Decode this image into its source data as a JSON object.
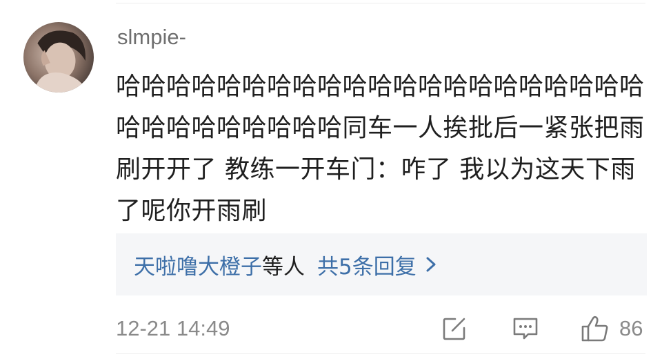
{
  "comment": {
    "username": "slmpie-",
    "text": "哈哈哈哈哈哈哈哈哈哈哈哈哈哈哈哈哈哈哈哈哈哈哈哈哈哈哈哈哈哈同车一人挨批后一紧张把雨刷开开了 教练一开车门：咋了 我以为这天下雨了呢你开雨刷",
    "avatar_icon": "user-avatar-photo"
  },
  "replies": {
    "names": "天啦噜大橙子",
    "etc": "等人",
    "count_label": "共5条回复",
    "chevron_icon": "chevron-right-icon",
    "link_color": "#3d6fa8"
  },
  "footer": {
    "timestamp": "12-21 14:49",
    "edit_icon": "share-edit-icon",
    "comment_icon": "comment-bubble-icon",
    "like_icon": "thumbs-up-icon",
    "like_count": "86"
  }
}
